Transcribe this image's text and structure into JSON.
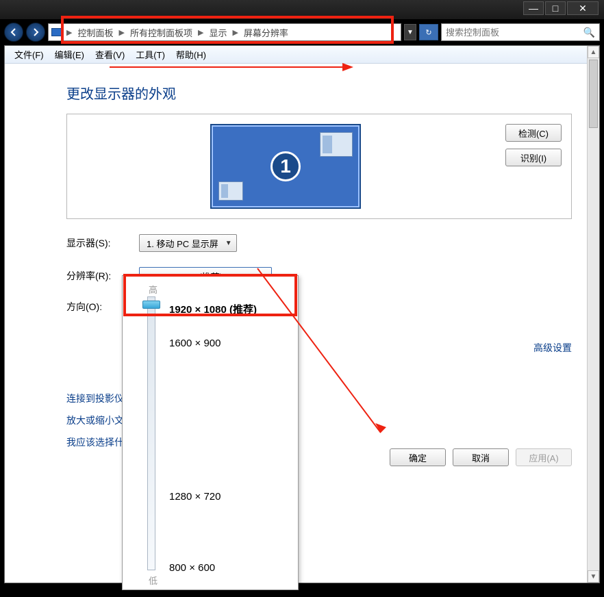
{
  "window": {
    "min": "—",
    "max": "□",
    "close": "✕"
  },
  "breadcrumb": {
    "items": [
      "控制面板",
      "所有控制面板项",
      "显示",
      "屏幕分辨率"
    ]
  },
  "search": {
    "placeholder": "搜索控制面板"
  },
  "menu": {
    "file": "文件(F)",
    "edit": "编辑(E)",
    "view": "查看(V)",
    "tools": "工具(T)",
    "help": "帮助(H)"
  },
  "page": {
    "title": "更改显示器的外观",
    "monitor_number": "1",
    "detect": "检测(C)",
    "identify": "识别(I)"
  },
  "form": {
    "display_label": "显示器(S):",
    "display_value": "1. 移动 PC 显示屏",
    "resolution_label": "分辨率(R):",
    "resolution_value": "1920 × 1080 (推荐)",
    "orientation_label": "方向(O):"
  },
  "resolution_popup": {
    "high": "高",
    "low": "低",
    "options": [
      "1920 × 1080 (推荐)",
      "1600 × 900",
      "1280 × 720",
      "800 × 600"
    ]
  },
  "links": {
    "advanced": "高级设置",
    "projector": "连接到投影仪 (",
    "zoom": "放大或缩小文本",
    "which": "我应该选择什么"
  },
  "actions": {
    "ok": "确定",
    "cancel": "取消",
    "apply": "应用(A)"
  }
}
